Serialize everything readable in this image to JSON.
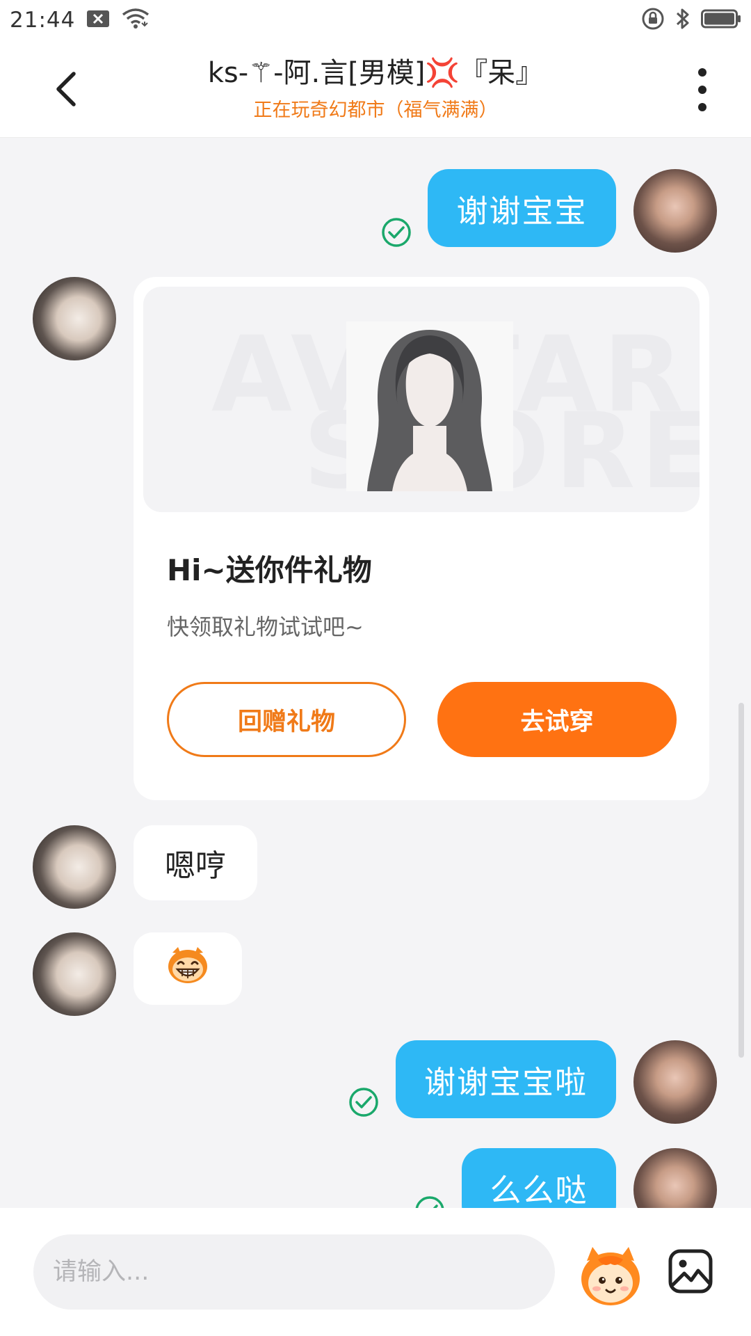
{
  "status_bar": {
    "time": "21:44",
    "icons": [
      "notification-icon",
      "wifi-icon",
      "lock-icon",
      "bluetooth-icon",
      "battery-icon"
    ]
  },
  "header": {
    "title": "ks-⚚-阿.言[男模]💢『呆』",
    "subtitle": "正在玩奇幻都市（福气满满）",
    "back_icon": "chevron-left-icon",
    "more_icon": "more-vertical-icon"
  },
  "messages": [
    {
      "side": "right",
      "type": "text",
      "text": "谢谢宝宝",
      "status": "sent"
    },
    {
      "side": "left",
      "type": "gift_card",
      "banner_watermark": [
        "AVATAR",
        "STORE"
      ],
      "title": "Hi~送你件礼物",
      "description": "快领取礼物试试吧~",
      "secondary_button": "回赠礼物",
      "primary_button": "去试穿"
    },
    {
      "side": "left",
      "type": "text",
      "text": "嗯哼"
    },
    {
      "side": "left",
      "type": "sticker",
      "icon": "grinning-monkey-icon"
    },
    {
      "side": "right",
      "type": "text",
      "text": "谢谢宝宝啦",
      "status": "sent"
    },
    {
      "side": "right",
      "type": "text",
      "text": "么么哒",
      "status": "sent"
    }
  ],
  "input_bar": {
    "placeholder": "请输入...",
    "value": "",
    "emoji_icon": "mascot-emoji-icon",
    "image_icon": "image-icon"
  },
  "colors": {
    "accent_orange": "#ff7212",
    "bubble_blue": "#2eb8f5",
    "check_green": "#1aa86b",
    "background": "#f4f4f6"
  }
}
